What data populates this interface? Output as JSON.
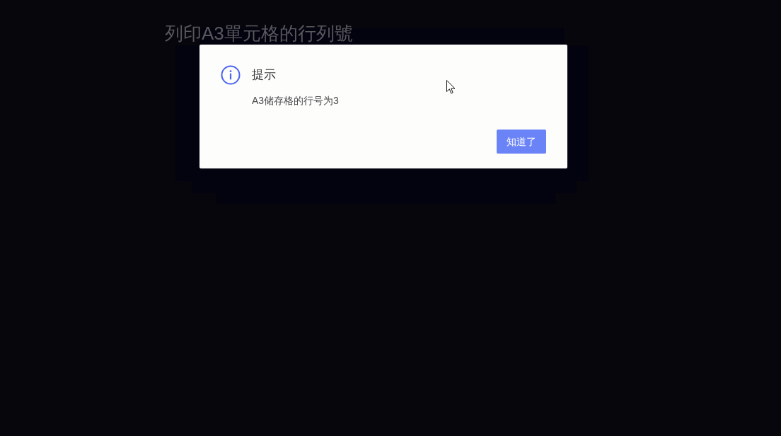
{
  "page": {
    "title": "列印A3單元格的行列號"
  },
  "dialog": {
    "title": "提示",
    "message": "A3储存格的行号为3",
    "buttons": [
      {
        "label": "知道了"
      }
    ]
  }
}
